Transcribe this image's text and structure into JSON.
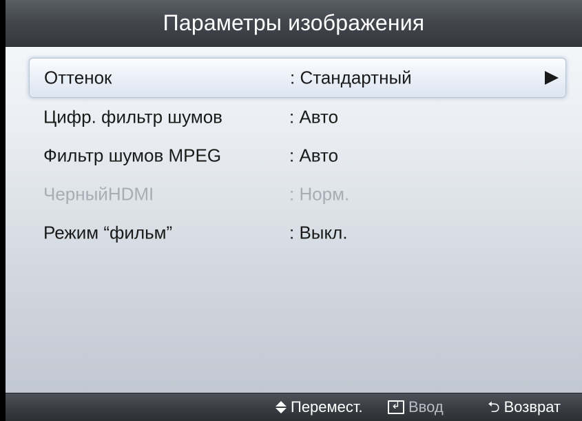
{
  "header": {
    "title": "Параметры изображения"
  },
  "menu": {
    "items": [
      {
        "label": "Оттенок",
        "value": ": Стандартный",
        "selected": true,
        "disabled": false
      },
      {
        "label": "Цифр. фильтр шумов",
        "value": ": Авто",
        "selected": false,
        "disabled": false
      },
      {
        "label": "Фильтр шумов MPEG",
        "value": ": Авто",
        "selected": false,
        "disabled": false
      },
      {
        "label": "ЧерныйHDMI",
        "value": ": Норм.",
        "selected": false,
        "disabled": true
      },
      {
        "label": "Режим “фильм”",
        "value": ": Выкл.",
        "selected": false,
        "disabled": false
      }
    ]
  },
  "footer": {
    "move_label": "Перемест.",
    "enter_label": "Ввод",
    "return_label": "Возврат",
    "move_icon": "up-down-icon",
    "enter_icon": "enter-icon",
    "return_icon": "return-icon"
  },
  "colors": {
    "header_bg": "#44484e",
    "panel_bg": "#e7ebf0",
    "selected_border": "#b9c6d6",
    "text": "#1a1a1a",
    "disabled_text": "#a8adb4"
  }
}
